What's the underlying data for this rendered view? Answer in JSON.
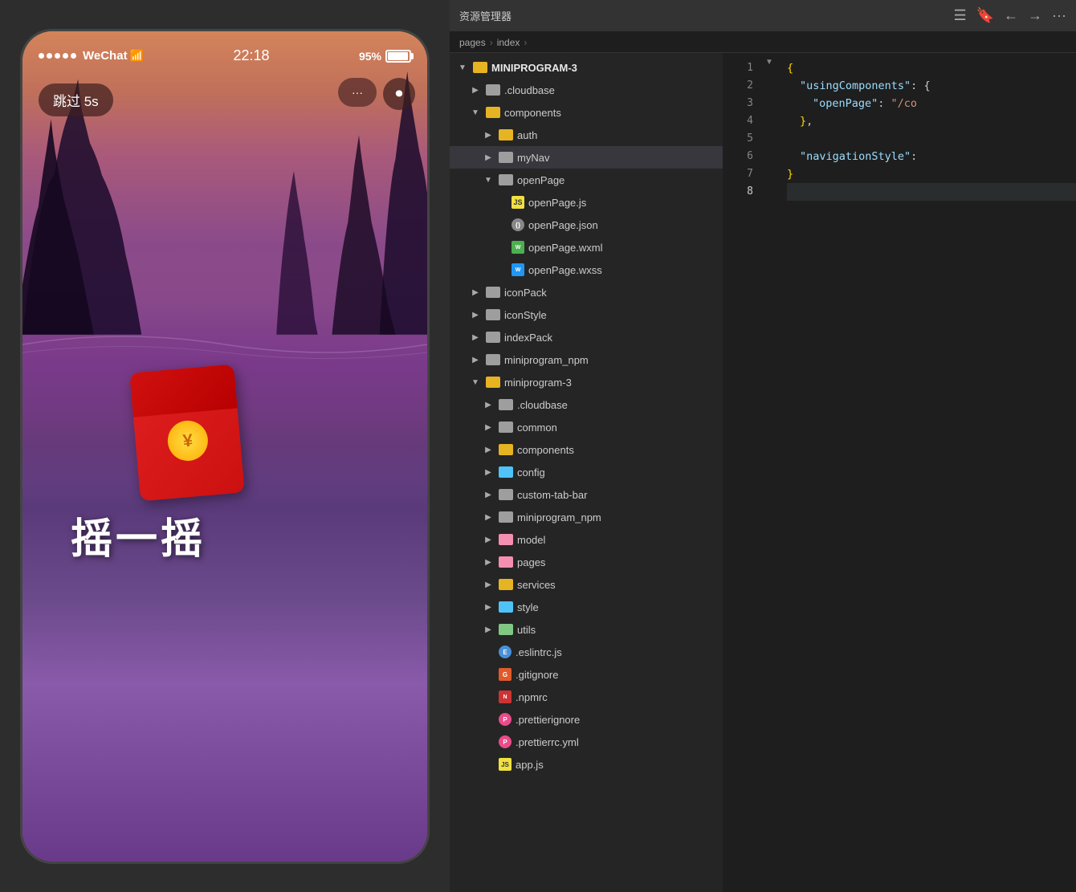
{
  "phone": {
    "status_bar": {
      "signal_dots": 5,
      "carrier": "WeChat",
      "wifi": "📶",
      "time": "22:18",
      "battery_percent": "95%"
    },
    "skip_button": "跳过 5s",
    "controls": {
      "dots": "···",
      "record": "⏺"
    },
    "shake_text": "摇一摇"
  },
  "explorer": {
    "title": "资源管理器",
    "more_icon": "···",
    "breadcrumb": {
      "part1": "pages",
      "sep1": ">",
      "part2": "index",
      "sep2": ">"
    },
    "root": "MINIPROGRAM-3",
    "tree": [
      {
        "level": 2,
        "expanded": false,
        "type": "folder",
        "color": "gray",
        "name": ".cloudbase"
      },
      {
        "level": 2,
        "expanded": true,
        "type": "folder",
        "color": "yellow",
        "name": "components"
      },
      {
        "level": 3,
        "expanded": false,
        "type": "folder",
        "color": "yellow",
        "name": "auth"
      },
      {
        "level": 3,
        "expanded": false,
        "type": "folder",
        "color": "gray",
        "name": "myNav",
        "active": true
      },
      {
        "level": 3,
        "expanded": true,
        "type": "folder",
        "color": "gray",
        "name": "openPage"
      },
      {
        "level": 4,
        "expanded": false,
        "type": "file",
        "color": "js",
        "name": "openPage.js"
      },
      {
        "level": 4,
        "expanded": false,
        "type": "file",
        "color": "json",
        "name": "openPage.json"
      },
      {
        "level": 4,
        "expanded": false,
        "type": "file",
        "color": "wxml",
        "name": "openPage.wxml"
      },
      {
        "level": 4,
        "expanded": false,
        "type": "file",
        "color": "wxss",
        "name": "openPage.wxss"
      },
      {
        "level": 2,
        "expanded": false,
        "type": "folder",
        "color": "gray",
        "name": "iconPack"
      },
      {
        "level": 2,
        "expanded": false,
        "type": "folder",
        "color": "gray",
        "name": "iconStyle"
      },
      {
        "level": 2,
        "expanded": false,
        "type": "folder",
        "color": "gray",
        "name": "indexPack"
      },
      {
        "level": 2,
        "expanded": false,
        "type": "folder",
        "color": "gray",
        "name": "miniprogram_npm"
      },
      {
        "level": 2,
        "expanded": true,
        "type": "folder",
        "color": "yellow",
        "name": "miniprogram-3"
      },
      {
        "level": 3,
        "expanded": false,
        "type": "folder",
        "color": "gray",
        "name": ".cloudbase"
      },
      {
        "level": 3,
        "expanded": false,
        "type": "folder",
        "color": "gray",
        "name": "common"
      },
      {
        "level": 3,
        "expanded": false,
        "type": "folder",
        "color": "yellow",
        "name": "components"
      },
      {
        "level": 3,
        "expanded": false,
        "type": "folder",
        "color": "blue",
        "name": "config"
      },
      {
        "level": 3,
        "expanded": false,
        "type": "folder",
        "color": "gray",
        "name": "custom-tab-bar"
      },
      {
        "level": 3,
        "expanded": false,
        "type": "folder",
        "color": "gray",
        "name": "miniprogram_npm"
      },
      {
        "level": 3,
        "expanded": false,
        "type": "folder",
        "color": "pink",
        "name": "model"
      },
      {
        "level": 3,
        "expanded": false,
        "type": "folder",
        "color": "pink",
        "name": "pages"
      },
      {
        "level": 3,
        "expanded": false,
        "type": "folder",
        "color": "yellow",
        "name": "services"
      },
      {
        "level": 3,
        "expanded": false,
        "type": "folder",
        "color": "blue",
        "name": "style"
      },
      {
        "level": 3,
        "expanded": false,
        "type": "folder",
        "color": "green",
        "name": "utils"
      },
      {
        "level": 3,
        "expanded": false,
        "type": "file",
        "color": "eslint",
        "name": ".eslintrc.js"
      },
      {
        "level": 3,
        "expanded": false,
        "type": "file",
        "color": "git",
        "name": ".gitignore"
      },
      {
        "level": 3,
        "expanded": false,
        "type": "file",
        "color": "npm",
        "name": ".npmrc"
      },
      {
        "level": 3,
        "expanded": false,
        "type": "file",
        "color": "prettier",
        "name": ".prettierignore"
      },
      {
        "level": 3,
        "expanded": false,
        "type": "file",
        "color": "prettier",
        "name": ".prettierrc.yml"
      },
      {
        "level": 3,
        "expanded": false,
        "type": "file",
        "color": "js",
        "name": "app.js"
      }
    ],
    "code": {
      "lines": [
        {
          "num": 1,
          "active": false,
          "has_fold": true,
          "content": "{"
        },
        {
          "num": 2,
          "active": false,
          "has_fold": false,
          "content": "  \"usingComponents\":"
        },
        {
          "num": 3,
          "active": false,
          "has_fold": false,
          "content": "    \"openPage\": \"/co"
        },
        {
          "num": 4,
          "active": false,
          "has_fold": false,
          "content": "  },"
        },
        {
          "num": 5,
          "active": false,
          "has_fold": false,
          "content": ""
        },
        {
          "num": 6,
          "active": false,
          "has_fold": false,
          "content": "  \"navigationStyle\":"
        },
        {
          "num": 7,
          "active": false,
          "has_fold": false,
          "content": "}"
        },
        {
          "num": 8,
          "active": true,
          "has_fold": false,
          "content": ""
        }
      ]
    }
  }
}
